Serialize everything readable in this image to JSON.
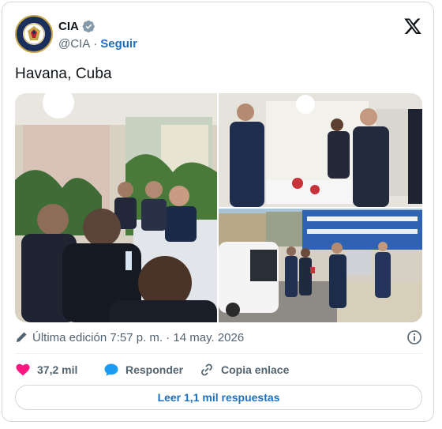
{
  "author": {
    "name": "CIA",
    "handle": "@CIA",
    "separator": "·",
    "follow_label": "Seguir"
  },
  "tweet": {
    "text": "Havana, Cuba"
  },
  "meta": {
    "edited_label": "Última edición 7:57 p. m. · 14 may. 2026"
  },
  "actions": {
    "likes": "37,2 mil",
    "reply_label": "Responder",
    "copy_link_label": "Copia enlace"
  },
  "footer": {
    "read_replies_label": "Leer 1,1 mil respuestas"
  },
  "colors": {
    "accent": "#1d6fbf",
    "like": "#f91880",
    "muted": "#536471",
    "border": "#cfd9de"
  },
  "icons": [
    "verified-badge-icon",
    "x-logo-icon",
    "pencil-icon",
    "info-icon",
    "heart-icon",
    "reply-bubble-icon",
    "link-icon"
  ]
}
